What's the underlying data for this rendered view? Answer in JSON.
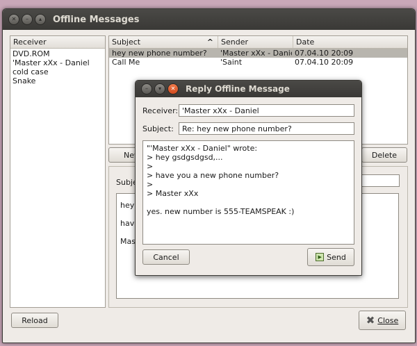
{
  "window": {
    "title": "Offline Messages"
  },
  "receivers": {
    "header": "Receiver",
    "items": [
      "DVD.ROM",
      "'Master xXx - Daniel",
      "cold case",
      "Snake"
    ]
  },
  "messages": {
    "columns": {
      "subject": "Subject",
      "sender": "Sender",
      "date": "Date"
    },
    "sort_icon": "^",
    "rows": [
      {
        "subject": "hey new phone number?",
        "sender": "'Master xXx - Daniel",
        "date": "07.04.10 20:09"
      },
      {
        "subject": "Call Me",
        "sender": "'Saint",
        "date": "07.04.10 20:09"
      }
    ]
  },
  "buttons": {
    "new": "New",
    "delete": "Delete",
    "reload": "Reload",
    "close": "Close"
  },
  "preview": {
    "subject_label": "Subject",
    "lines": [
      "hey g",
      "have",
      "Mast"
    ]
  },
  "dialog": {
    "title": "Reply Offline Message",
    "receiver_label": "Receiver:",
    "receiver_value": "'Master xXx - Daniel",
    "subject_label": "Subject:",
    "subject_value": "Re: hey new phone number?",
    "body": "\"'Master xXx - Daniel\" wrote:\n> hey gsdgsdgsd,...\n>\n> have you a new phone number?\n>\n> Master xXx\n\nyes. new number is 555-TEAMSPEAK :)",
    "cancel": "Cancel",
    "send": "Send"
  },
  "colors": {
    "selected_row": "#b8b5ae",
    "titlebar": "#3a3936"
  }
}
